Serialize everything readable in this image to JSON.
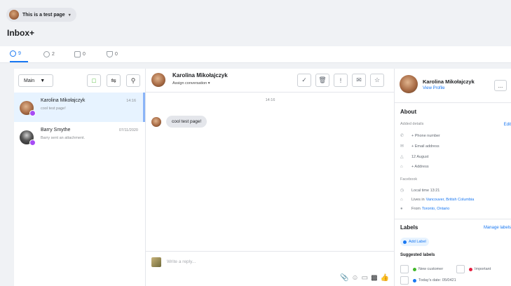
{
  "header": {
    "page_name": "This is a test page",
    "caret": "▾",
    "title": "Inbox+"
  },
  "tabs": [
    {
      "icon": "inbox-icon",
      "count": "9"
    },
    {
      "icon": "messenger-icon",
      "count": "2"
    },
    {
      "icon": "instagram-icon",
      "count": "0"
    },
    {
      "icon": "comment-icon",
      "count": "0"
    }
  ],
  "list": {
    "filter_label": "Main",
    "filter_caret": "▼",
    "conversations": [
      {
        "name": "Karolina Mikołajczyk",
        "preview": "cool test page!",
        "time": "14:16"
      },
      {
        "name": "Barry Smythe",
        "preview": "Barry sent an attachment.",
        "time": "07/11/2020"
      }
    ]
  },
  "chat": {
    "contact_name": "Karolina Mikołajczyk",
    "assign_label": "Assign conversation",
    "assign_caret": "▾",
    "timestamp": "14:16",
    "message": "cool test page!",
    "reply_placeholder": "Write a reply..."
  },
  "profile": {
    "name": "Karolina Mikołajczyk",
    "view_profile": "View Profile",
    "more": "...",
    "about_title": "About",
    "added_details": "Added details",
    "edit": "Edit",
    "phone": "+ Phone number",
    "email": "+ Email address",
    "birthday": "12 August",
    "address": "+ Address",
    "facebook": "Facebook",
    "local_time": "Local time 13:21",
    "lives_in_prefix": "Lives in",
    "lives_in": "Vancouver, British Columbia",
    "from_prefix": "From",
    "from": "Toronto, Ontario",
    "labels_title": "Labels",
    "manage_labels": "Manage labels",
    "add_label": "Add Label",
    "suggested_labels": "Suggested labels",
    "suggestions": [
      {
        "text": "New customer",
        "color": "#42b72a"
      },
      {
        "text": "Important",
        "color": "#e41e3f"
      },
      {
        "text": "Today's date: 05/0421",
        "color": "#1877f2"
      }
    ]
  }
}
